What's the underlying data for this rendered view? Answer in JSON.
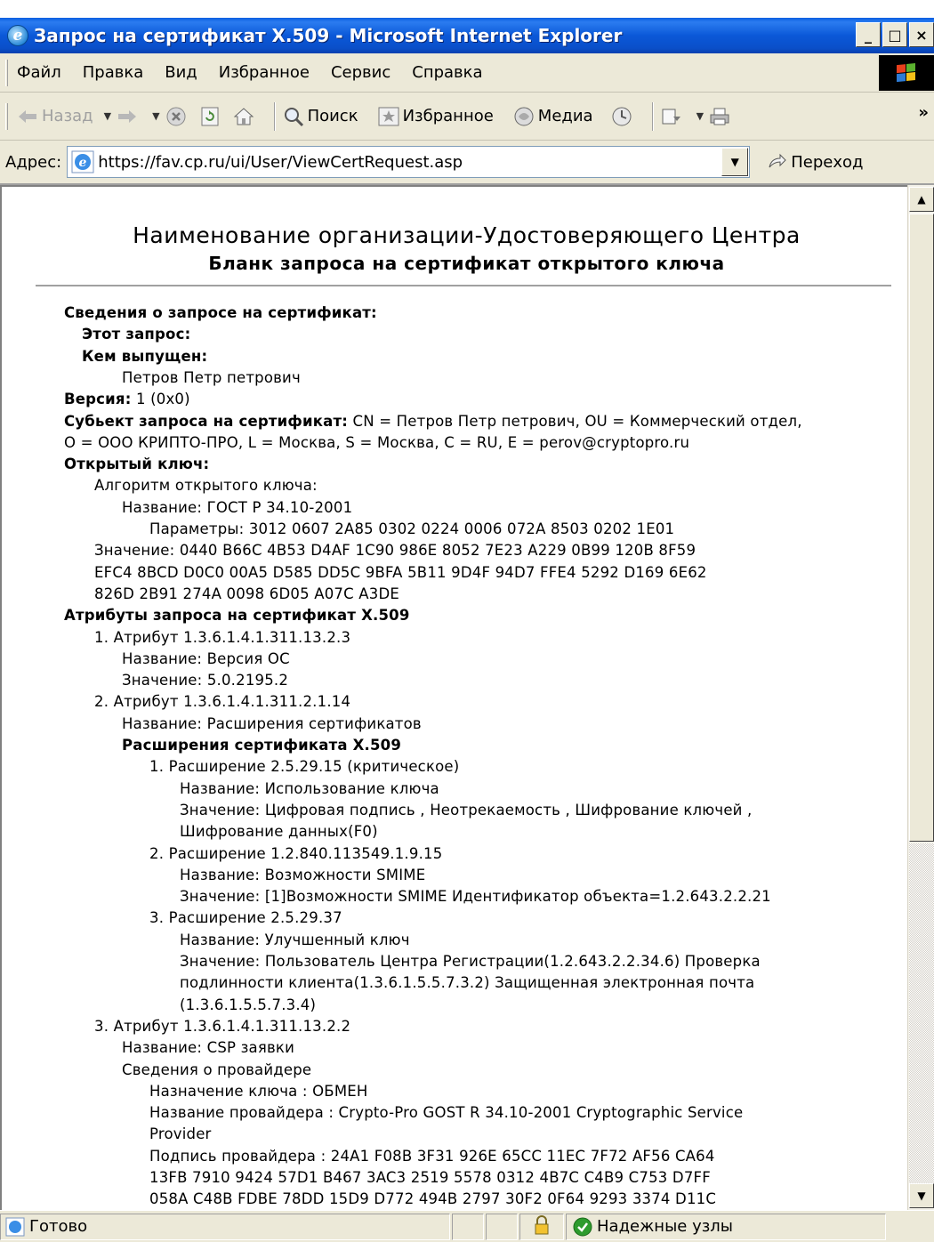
{
  "window": {
    "title": "Запрос на сертификат X.509 - Microsoft Internet Explorer",
    "minimize": "_",
    "maximize": "□",
    "close": "×"
  },
  "menu": {
    "file": "Файл",
    "edit": "Правка",
    "view": "Вид",
    "favorites": "Избранное",
    "tools": "Сервис",
    "help": "Справка"
  },
  "toolbar": {
    "back": "Назад",
    "search": "Поиск",
    "favorites": "Избранное",
    "media": "Медиа",
    "more": "»"
  },
  "address": {
    "label": "Адрес:",
    "url": "https://fav.cp.ru/ui/User/ViewCertRequest.asp",
    "go": "Переход"
  },
  "doc": {
    "title": "Наименование организации-Удостоверяющего Центра",
    "subtitle": "Бланк запроса на сертификат открытого ключа",
    "lines": [
      {
        "b": "Сведения о запросе на сертификат:",
        "t": ""
      },
      {
        "b": "Этот запрос:",
        "t": ""
      },
      {
        "b": "Кем выпущен:",
        "t": ""
      },
      {
        "b": "",
        "t": "Петров Петр петрович"
      },
      {
        "b": "Версия:",
        "t": " 1 (0x0)"
      },
      {
        "b": "Субьект запроса на сертификат:",
        "t": " CN = Петров Петр петрович, OU = Коммерческий отдел,"
      },
      {
        "b": "",
        "t": "O = ООО КРИПТО-ПРО, L = Москва, S = Москва, C = RU, E = perov@cryptopro.ru"
      },
      {
        "b": "Открытый ключ:",
        "t": ""
      },
      {
        "b": "",
        "t": "Алгоритм открытого ключа:"
      },
      {
        "b": "",
        "t": "Название: ГОСТ Р 34.10-2001"
      },
      {
        "b": "",
        "t": "Параметры: 3012 0607 2A85 0302 0224 0006 072A 8503 0202 1E01"
      },
      {
        "b": "",
        "t": "Значение: 0440 B66C 4B53 D4AF 1C90 986E 8052 7E23 A229 0B99 120B 8F59"
      },
      {
        "b": "",
        "t": "EFC4 8BCD D0C0 00A5 D585 DD5C 9BFA 5B11 9D4F 94D7 FFE4 5292 D169 6E62"
      },
      {
        "b": "",
        "t": "826D 2B91 274A 0098 6D05 A07C A3DE"
      },
      {
        "b": "Атрибуты запроса на сертификат X.509",
        "t": ""
      },
      {
        "b": "",
        "t": "1. Атрибут 1.3.6.1.4.1.311.13.2.3"
      },
      {
        "b": "",
        "t": "Название: Версия ОС"
      },
      {
        "b": "",
        "t": "Значение: 5.0.2195.2"
      },
      {
        "b": "",
        "t": "2. Атрибут 1.3.6.1.4.1.311.2.1.14"
      },
      {
        "b": "",
        "t": "Название: Расширения сертификатов"
      },
      {
        "b": "Расширения сертификата X.509",
        "t": ""
      },
      {
        "b": "",
        "t": "1. Расширение 2.5.29.15 (критическое)"
      },
      {
        "b": "",
        "t": "Название: Использование ключа"
      },
      {
        "b": "",
        "t": "Значение: Цифровая подпись , Неотрекаемость , Шифрование ключей ,"
      },
      {
        "b": "",
        "t": "Шифрование данных(F0)"
      },
      {
        "b": "",
        "t": "2. Расширение 1.2.840.113549.1.9.15"
      },
      {
        "b": "",
        "t": "Название: Возможности SMIME"
      },
      {
        "b": "",
        "t": "Значение: [1]Возможности SMIME Идентификатор объекта=1.2.643.2.2.21"
      },
      {
        "b": "",
        "t": "3. Расширение 2.5.29.37"
      },
      {
        "b": "",
        "t": "Название: Улучшенный ключ"
      },
      {
        "b": "",
        "t": "Значение: Пользователь Центра Регистрации(1.2.643.2.2.34.6) Проверка"
      },
      {
        "b": "",
        "t": "подлинности клиента(1.3.6.1.5.5.7.3.2) Защищенная электронная почта"
      },
      {
        "b": "",
        "t": "(1.3.6.1.5.5.7.3.4)"
      },
      {
        "b": "",
        "t": "3. Атрибут 1.3.6.1.4.1.311.13.2.2"
      },
      {
        "b": "",
        "t": "Название: CSP заявки"
      },
      {
        "b": "",
        "t": "Сведения о провайдере"
      },
      {
        "b": "",
        "t": "Назначение ключа : ОБМЕН"
      },
      {
        "b": "",
        "t": "Название провайдера : Crypto-Pro GOST R 34.10-2001 Cryptographic Service"
      },
      {
        "b": "",
        "t": "Provider"
      },
      {
        "b": "",
        "t": "Подпись провайдера : 24A1 F08B 3F31 926E 65CC 11EC 7F72 AF56 CA64"
      },
      {
        "b": "",
        "t": "13FB 7910 9424 57D1 B467 3AC3 2519 5578 0312 4B7C C4B9 C753 D7FF"
      },
      {
        "b": "",
        "t": "058A C48B FDBE 78DD 15D9 D772 494B 2797 30F2 0F64 9293 3374 D11C"
      }
    ]
  },
  "status": {
    "ready": "Готово",
    "zone": "Надежные узлы"
  }
}
